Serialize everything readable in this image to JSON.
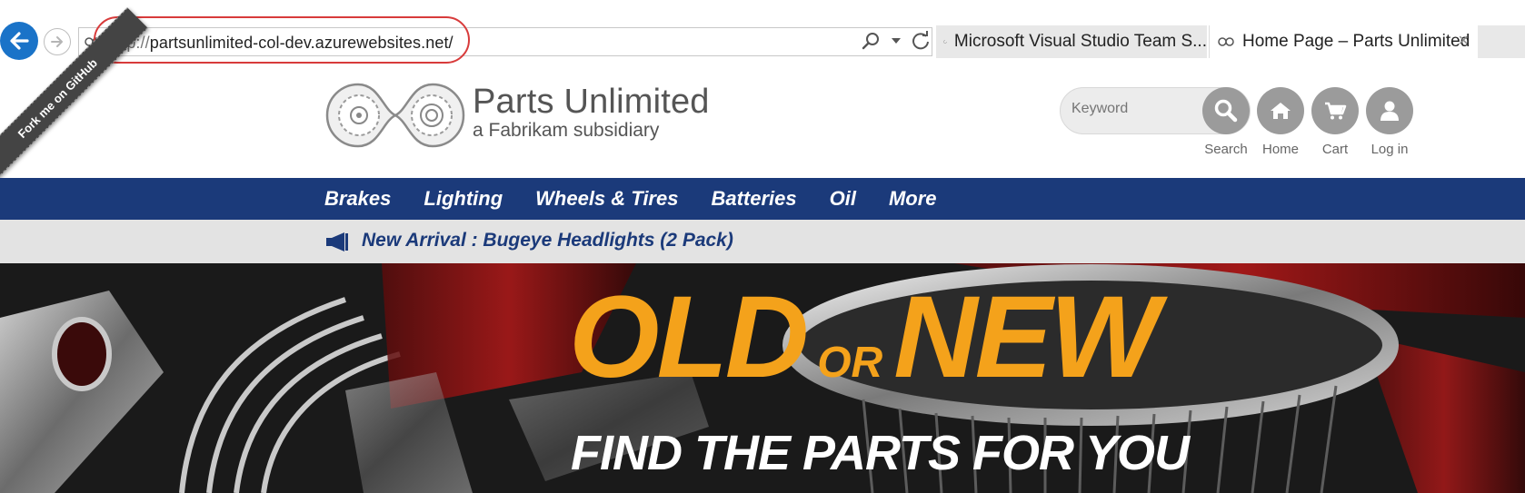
{
  "browser": {
    "url_protocol": "http://",
    "url_host": "partsunlimited-col-dev.azurewebsites.net/",
    "tabs": [
      {
        "label": "Microsoft Visual Studio Team S..."
      },
      {
        "label": "Home Page – Parts Unlimited",
        "close": "×"
      }
    ]
  },
  "ribbon": {
    "text": "Fork me on GitHub"
  },
  "header": {
    "brand_title": "Parts Unlimited",
    "brand_subtitle": "a Fabrikam subsidiary",
    "search_placeholder": "Keyword",
    "actions": {
      "search": "Search",
      "home": "Home",
      "cart": "Cart",
      "login": "Log in"
    }
  },
  "nav": {
    "items": [
      "Brakes",
      "Lighting",
      "Wheels & Tires",
      "Batteries",
      "Oil",
      "More"
    ]
  },
  "promo": {
    "text": "New Arrival : Bugeye Headlights (2 Pack)"
  },
  "hero": {
    "word_old": "OLD",
    "word_or": "OR",
    "word_new": "NEW",
    "tagline": "FIND THE PARTS FOR YOU"
  },
  "colors": {
    "nav_bg": "#1b3a7a",
    "hero_accent": "#f4a21b",
    "url_highlight": "#d83b3b",
    "back_button": "#1a73c8"
  }
}
